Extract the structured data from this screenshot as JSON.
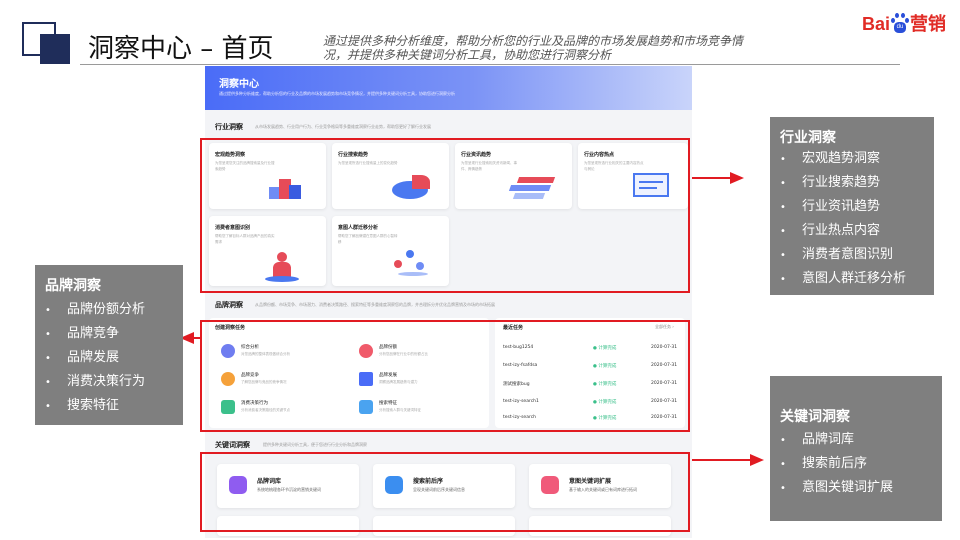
{
  "header": {
    "title": "洞察中心 – 首页",
    "description": "通过提供多种分析维度，帮助分析您的行业及品牌的市场发展趋势和市场竞争情况，并提供多种关键词分析工具，协助您进行洞察分析"
  },
  "logo": {
    "text_bai": "Bai",
    "text_du": "du",
    "text_ying": "营销"
  },
  "screenshot": {
    "banner": {
      "title": "洞察中心",
      "desc": "通过提供多种分析维度，帮助分析您的行业及品牌的市场发展趋势和市场竞争情况，并提供多种关键词分析工具，协助您进行洞察分析"
    },
    "industry": {
      "title": "行业洞察",
      "desc": "从市场发展趋势、行业用户行为、行业竞争格局等多重维度洞察行业走势，帮助您更好了解行业发展",
      "cards": [
        {
          "title": "宏观趋势洞察",
          "desc": "为您呈现您关注的品牌搜索量及行业搜索趋势"
        },
        {
          "title": "行业搜索趋势",
          "desc": "为您呈现所选行业搜索量上的变化趋势"
        },
        {
          "title": "行业资讯趋势",
          "desc": "为您呈现行业搜索相关资讯新闻、事件、舆情趋势"
        },
        {
          "title": "行业内容热点",
          "desc": "为您呈现所选行业相关的主要内容热点与舆论"
        },
        {
          "title": "消费者意图识别",
          "desc": "帮助您了解目标人群对品牌产品的真实需求"
        },
        {
          "title": "意图人群迁移分析",
          "desc": "帮助您了解品牌潜在意图人群的心智转移"
        }
      ]
    },
    "brand": {
      "title": "品牌洞察",
      "desc": "从品牌份额、市场竞争、市场潜力、消费者决策路径、搜索特征等多重维度洞察您的品牌，并合理拆分并优化品牌营销及市场的市场拓展",
      "tasks_title": "创建洞察任务",
      "tasks": [
        {
          "name": "综合分析",
          "desc": "对您品牌的整体表现做综合分析",
          "color": "#6f7df0"
        },
        {
          "name": "品牌份额",
          "desc": "分析您品牌在行业中的份额占比",
          "color": "#f05a6a"
        },
        {
          "name": "品牌竞争",
          "desc": "了解您品牌与竞品的竞争情况",
          "color": "#f5a13a"
        },
        {
          "name": "品牌发展",
          "desc": "洞察品牌发展趋势与潜力",
          "color": "#4a6cf7"
        },
        {
          "name": "消费决策行为",
          "desc": "分析消费者决策路径的关键节点",
          "color": "#3bc08b"
        },
        {
          "name": "搜索特征",
          "desc": "分析搜索人群与关键词特征",
          "color": "#4aa3f0"
        }
      ],
      "recent_title": "最近任务",
      "recent_all": "全部任务 ›",
      "recent": [
        {
          "name": "test-bug1254",
          "status": "● 计算完成",
          "date": "2020-07-31"
        },
        {
          "name": "test-izy-fsafdsa",
          "status": "● 计算完成",
          "date": "2020-07-31"
        },
        {
          "name": "测试搜索bug",
          "status": "● 计算完成",
          "date": "2020-07-31"
        },
        {
          "name": "test-izy-search1",
          "status": "● 计算完成",
          "date": "2020-07-31"
        },
        {
          "name": "test-izy-search",
          "status": "● 计算完成",
          "date": "2020-07-31"
        }
      ]
    },
    "keyword": {
      "title": "关键词洞察",
      "desc": "提供多种关键词分析工具，便于您进行行业分析和品牌洞察",
      "cards": [
        {
          "title": "品牌词库",
          "desc": "系统地梳理各环节沉淀的营销关键词",
          "color": "#8f5cf0"
        },
        {
          "title": "搜索前后序",
          "desc": "呈现关键词前后序关键词信息",
          "color": "#3b8ef0"
        },
        {
          "title": "意图关键词扩展",
          "desc": "基于输入的关键词或已有词库进行拓词",
          "color": "#f05a7a"
        }
      ]
    }
  },
  "callouts": {
    "industry": {
      "title": "行业洞察",
      "items": [
        "宏观趋势洞察",
        "行业搜索趋势",
        "行业资讯趋势",
        "行业热点内容",
        "消费者意图识别",
        "意图人群迁移分析"
      ]
    },
    "brand": {
      "title": "品牌洞察",
      "items": [
        "品牌份额分析",
        "品牌竞争",
        "品牌发展",
        "消费决策行为",
        "搜索特征"
      ]
    },
    "keyword": {
      "title": "关键词洞察",
      "items": [
        "品牌词库",
        "搜索前后序",
        "意图关键词扩展"
      ]
    }
  },
  "colors": {
    "accent_red": "#e11b22",
    "navy": "#1f2d5a",
    "callout_grey": "#7f7f7f",
    "baidu_blue": "#2a4fd9"
  }
}
